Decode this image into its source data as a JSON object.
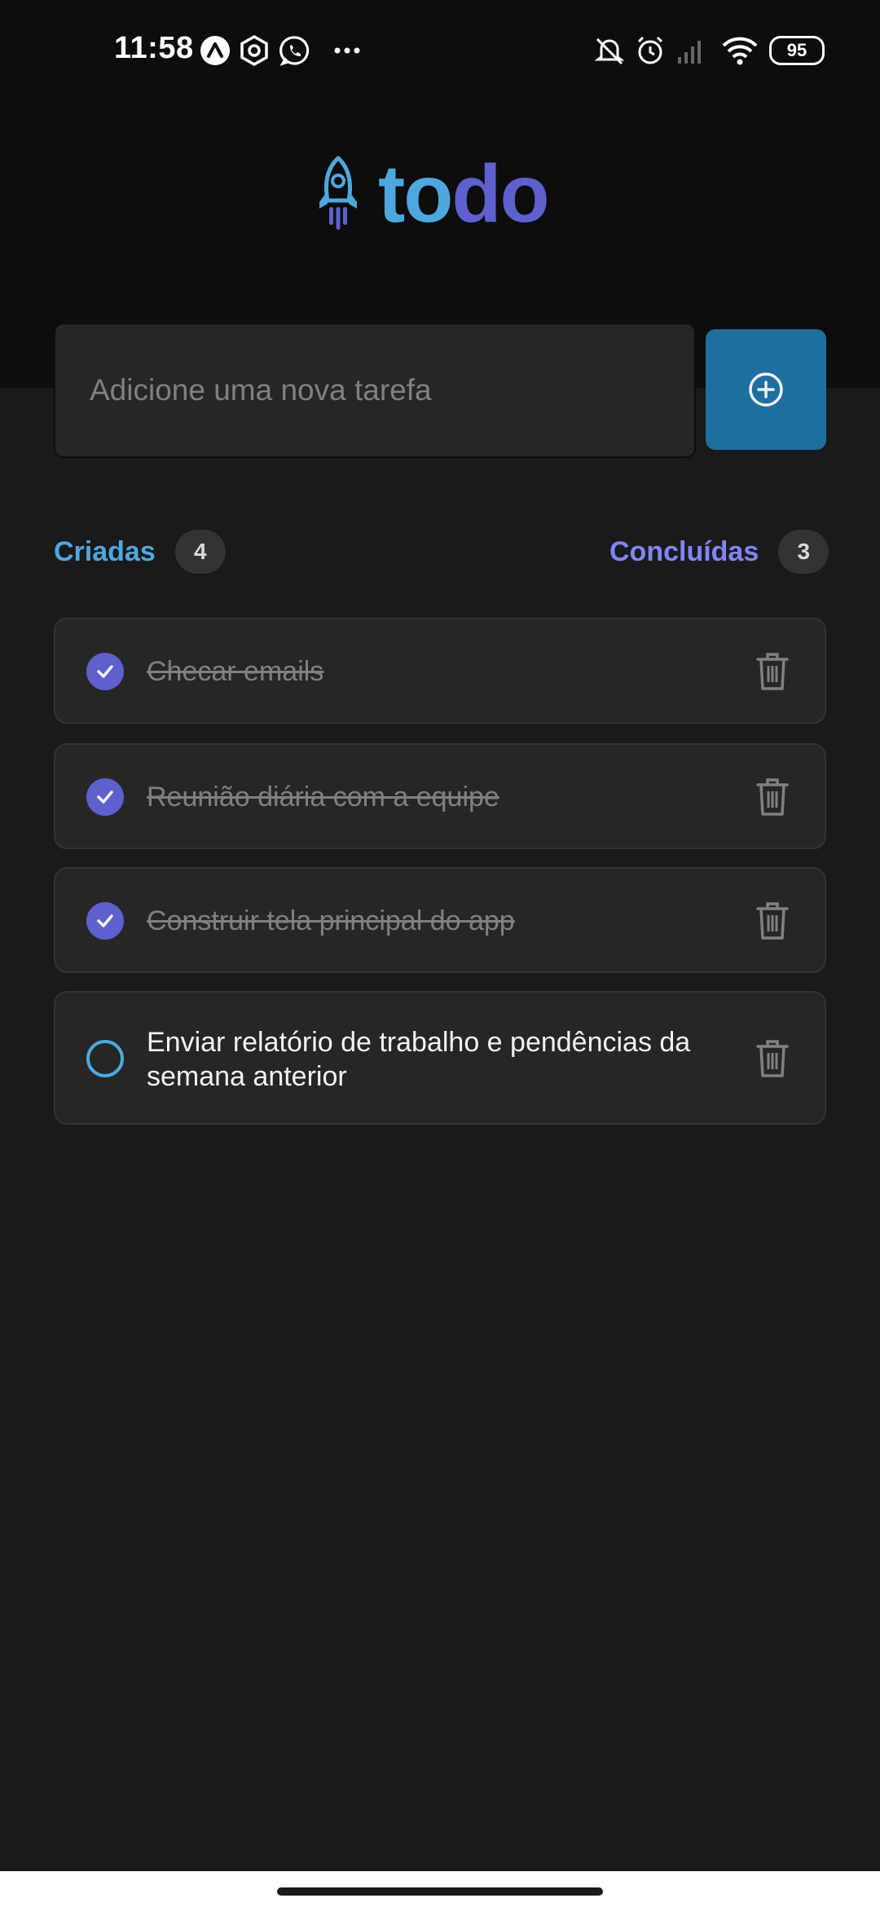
{
  "status_bar": {
    "time": "11:58",
    "battery": "95",
    "left_icons": [
      "autonomous-a-icon",
      "hexagon-settings-icon",
      "whatsapp-icon",
      "more-dots-icon"
    ],
    "right_icons": [
      "muted-bell-icon",
      "alarm-icon",
      "signal-icon",
      "wifi-icon",
      "battery-icon"
    ]
  },
  "logo": {
    "part1": "to",
    "part2": "do",
    "icon": "rocket-icon"
  },
  "input": {
    "placeholder": "Adicione uma nova tarefa",
    "value": ""
  },
  "add_button": {
    "icon": "plus-circle-icon"
  },
  "counters": {
    "created_label": "Criadas",
    "created_count": "4",
    "done_label": "Concluídas",
    "done_count": "3"
  },
  "tasks": [
    {
      "text": "Checar emails",
      "done": true
    },
    {
      "text": "Reunião diária com a equipe",
      "done": true
    },
    {
      "text": "Construir tela principal do app",
      "done": true
    },
    {
      "text": "Enviar relatório de trabalho e pendências da semana anterior",
      "done": false
    }
  ],
  "colors": {
    "background": "#1a1a1a",
    "header": "#0d0d0d",
    "card": "#262626",
    "blue": "#4ea8de",
    "blue_dark": "#1e6f9f",
    "purple": "#5e60ce",
    "purple_light": "#8284fa"
  }
}
